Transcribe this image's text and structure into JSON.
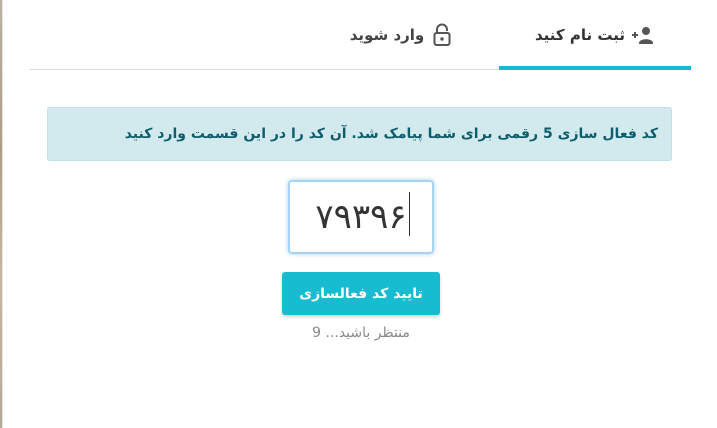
{
  "tabs": {
    "register": {
      "label": "ثبت نام کنید",
      "icon": "user-plus-icon",
      "active": true
    },
    "login": {
      "label": "وارد شوید",
      "icon": "unlock-icon",
      "active": false
    }
  },
  "alert": {
    "text": "کد فعال سازی 5 رقمی برای شما پیامک شد. آن کد را در این قسمت وارد کنید"
  },
  "code_input": {
    "value": "۷۹۳۹۶"
  },
  "confirm_button": {
    "label": "تایید کد فعالسازی"
  },
  "wait_text": "منتظر باشید... 9",
  "colors": {
    "accent": "#16b8cf",
    "alert_bg": "#d2eaee",
    "alert_text": "#0f5c6b"
  }
}
